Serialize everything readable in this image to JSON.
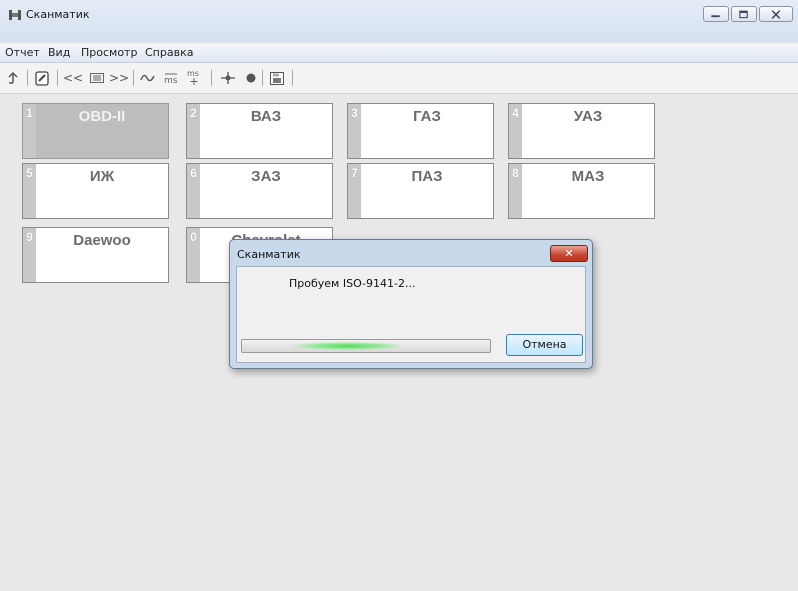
{
  "window": {
    "title": "Сканматик"
  },
  "menu": [
    "Отчет",
    "Вид",
    "Просмотр",
    "Справка"
  ],
  "toolbar": {
    "nav_prev": "<<",
    "nav_next": ">>"
  },
  "tiles": [
    {
      "num": "1",
      "label": "OBD-II",
      "active": true
    },
    {
      "num": "2",
      "label": "ВАЗ"
    },
    {
      "num": "3",
      "label": "ГАЗ"
    },
    {
      "num": "4",
      "label": "УАЗ"
    },
    {
      "num": "5",
      "label": "ИЖ"
    },
    {
      "num": "6",
      "label": "ЗАЗ"
    },
    {
      "num": "7",
      "label": "ПАЗ"
    },
    {
      "num": "8",
      "label": "МАЗ"
    },
    {
      "num": "9",
      "label": "Daewoo"
    },
    {
      "num": "0",
      "label": "Chevrolet"
    }
  ],
  "dialog": {
    "title": "Сканматик",
    "message": "Пробуем ISO-9141-2...",
    "cancel_label": "Отмена",
    "close_glyph": "✕",
    "progress_state": "marquee (indeterminate)"
  },
  "colors": {
    "tile_active_bg": "#bdbdbd",
    "progress_glow": "#4fdc55",
    "dialog_frame": "#c9d9ec"
  }
}
